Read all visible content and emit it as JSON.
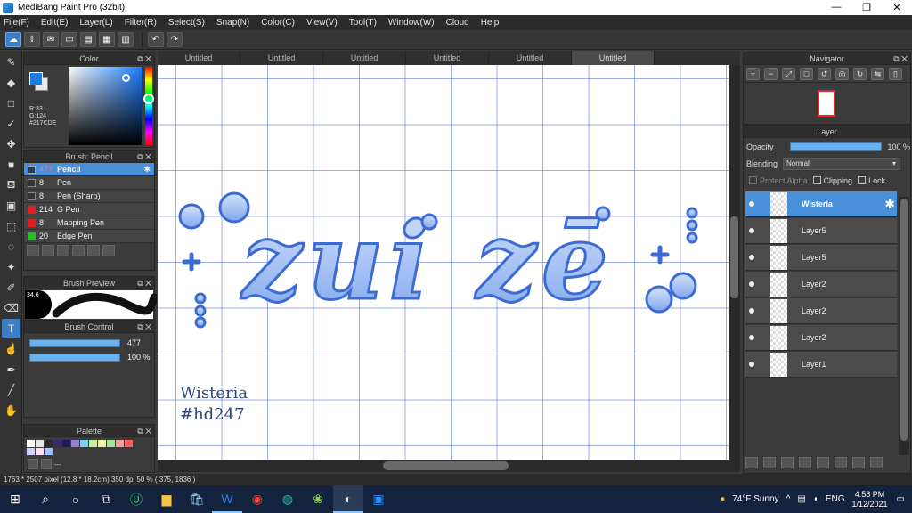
{
  "window": {
    "title": "MediBang Paint Pro (32bit)",
    "controls": [
      "—",
      "❐",
      "✕"
    ]
  },
  "menu": [
    "File(F)",
    "Edit(E)",
    "Layer(L)",
    "Filter(R)",
    "Select(S)",
    "Snap(N)",
    "Color(C)",
    "View(V)",
    "Tool(T)",
    "Window(W)",
    "Cloud",
    "Help"
  ],
  "tools": [
    "brush",
    "eraser",
    "rectangle",
    "pen",
    "move",
    "fill-rect",
    "bucket",
    "gradient",
    "select-rect",
    "lasso",
    "magic-wand",
    "select-pen",
    "select-eraser",
    "text",
    "operation",
    "eyedropper",
    "divide",
    "hand"
  ],
  "color_panel": {
    "title": "Color",
    "fg": "#217CDE",
    "r": "R:33",
    "g": "G:124",
    "hex": "#217CDE"
  },
  "brush_panel": {
    "title": "Brush: Pencil",
    "items": [
      {
        "size": "477",
        "name": "Pencil",
        "color": "#2a3a55"
      },
      {
        "size": "8",
        "name": "Pen",
        "color": "#333333"
      },
      {
        "size": "8",
        "name": "Pen (Sharp)",
        "color": "#333333"
      },
      {
        "size": "214",
        "name": "G Pen",
        "color": "#e02020"
      },
      {
        "size": "8",
        "name": "Mapping Pen",
        "color": "#e02020"
      },
      {
        "size": "20",
        "name": "Edge Pen",
        "color": "#20c020"
      }
    ]
  },
  "preview_panel": {
    "title": "Brush Preview",
    "value": "34.6"
  },
  "control_panel": {
    "title": "Brush Control",
    "size": "477",
    "opacity": "100 %"
  },
  "palette_panel": {
    "title": "Palette",
    "colors": [
      "#ffffff",
      "#e6e6e6",
      "#2a2a2a",
      "#3a2a6a",
      "#1a1a5a",
      "#9a7ad6",
      "#7ad6e6",
      "#c6f0a0",
      "#f0f0a0",
      "#a0e6a0",
      "#f0a0a0",
      "#f06060",
      "#d0d0ff",
      "#ffe0f0",
      "#a0c0ff"
    ],
    "label": "---"
  },
  "tabs": [
    {
      "label": "Untitled",
      "active": false
    },
    {
      "label": "Untitled",
      "active": false
    },
    {
      "label": "Untitled",
      "active": false
    },
    {
      "label": "Untitled",
      "active": false
    },
    {
      "label": "Untitled",
      "active": false
    },
    {
      "label": "Untitled",
      "active": true
    }
  ],
  "canvas": {
    "signature_line1": "Wisteria",
    "signature_line2": "#hd247",
    "artwork_text": "zui zē",
    "grid_color": "#4f69d6",
    "art_color": "#8fb4f2"
  },
  "status": "1763 * 2507 pixel   (12.8 * 18.2cm)   350 dpi   50 %   ( 375, 1836 )",
  "navigator": {
    "title": "Navigator"
  },
  "layer_panel": {
    "title": "Layer",
    "opacity_label": "Opacity",
    "opacity_value": "100 %",
    "blending_label": "Blending",
    "blending_value": "Normal",
    "protect_alpha": "Protect Alpha",
    "clipping": "Clipping",
    "lock": "Lock",
    "layers": [
      {
        "name": "Wisteria",
        "selected": true
      },
      {
        "name": "Layer5",
        "selected": false
      },
      {
        "name": "Layer5",
        "selected": false
      },
      {
        "name": "Layer2",
        "selected": false
      },
      {
        "name": "Layer2",
        "selected": false
      },
      {
        "name": "Layer2",
        "selected": false
      },
      {
        "name": "Layer1",
        "selected": false
      }
    ]
  },
  "taskbar": {
    "weather": "74°F  Sunny",
    "lang": "ENG",
    "time": "4:58 PM",
    "date": "1/12/2021"
  }
}
